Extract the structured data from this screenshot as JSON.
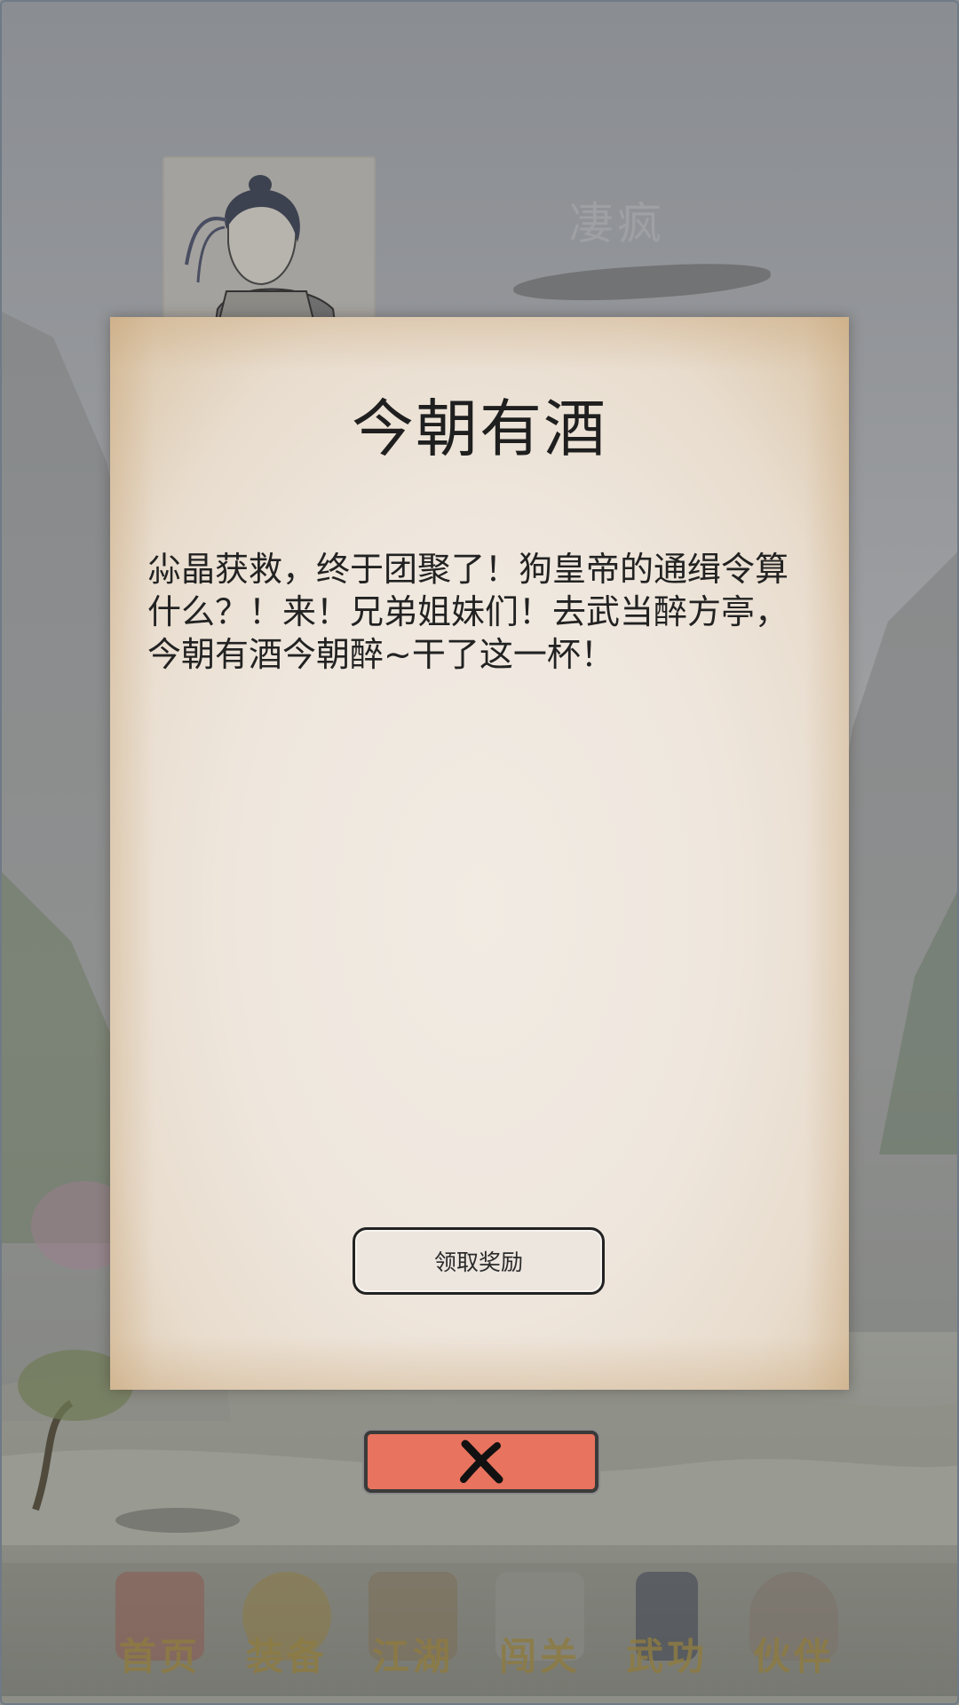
{
  "character": {
    "name": "凄疯"
  },
  "popup": {
    "title": "今朝有酒",
    "body": "尛晶获救，终于团聚了！狗皇帝的通缉令算什么？！来！兄弟姐妹们！去武当醉方亭，今朝有酒今朝醉~干了这一杯！",
    "claim_button_label": "领取奖励",
    "close_icon": "close-x-icon"
  },
  "bottom_nav": {
    "items": [
      {
        "label": "首页",
        "icon": "palace-icon"
      },
      {
        "label": "装备",
        "icon": "armor-icon"
      },
      {
        "label": "江湖",
        "icon": "scroll-map-icon"
      },
      {
        "label": "闯关",
        "icon": "crossed-swords-icon"
      },
      {
        "label": "武功",
        "icon": "manual-book-icon"
      },
      {
        "label": "伙伴",
        "icon": "companions-icon"
      }
    ]
  },
  "colors": {
    "close_button": "#e8735e",
    "nav_label": "#8d7b43",
    "overlay": "#8b8c8f"
  }
}
